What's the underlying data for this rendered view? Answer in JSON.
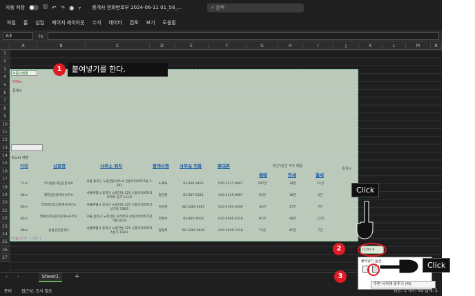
{
  "titlebar": {
    "autosave": "자동 저장",
    "doc_title": "중개사 전화번호부 2024-06-11 01_58_...",
    "search_placeholder": "검색"
  },
  "menu": [
    "파일",
    "홈",
    "삽입",
    "페이지 레이아웃",
    "수식",
    "데이터",
    "검토",
    "보기",
    "도움말"
  ],
  "formula_bar": {
    "name_box": "A3",
    "fx": "fx"
  },
  "columns": [
    "A",
    "B",
    "C",
    "D",
    "E",
    "F",
    "G",
    "H",
    "I",
    "J",
    "K",
    "L",
    "M",
    "N"
  ],
  "rows": [
    "1",
    "2",
    "3",
    "4",
    "5",
    "6",
    "7",
    "8",
    "9",
    "10",
    "11",
    "12",
    "13",
    "14",
    "15",
    "16",
    "17",
    "18",
    "19",
    "20",
    "21",
    "22",
    "23",
    "24",
    "25",
    "26",
    "27"
  ],
  "pasted": {
    "tag1": "부동산매물",
    "tag2": "500m",
    "tag3": "중개사",
    "excel_label": "Excel 저장",
    "header_note": "최근1달간 부유 매물",
    "headers": {
      "distance": "거리",
      "name": "상호명",
      "location": "사무소 위치",
      "broker": "중개사명",
      "phone": "사무실 전화",
      "rep": "휴대폰",
      "sale": "매매",
      "jeonse": "전세",
      "monthly": "월세",
      "agent": "중개사"
    },
    "rows": [
      {
        "d": "71m",
        "n": "유니빌중개공인중개사",
        "a": "서울 동작구 노량진동325-4 신동아리버파크빌 1-201",
        "b": "노혜숙",
        "p": "02-816-4422",
        "m": "010-2317-9467",
        "s": "197건",
        "j": "34건",
        "w": "12건"
      },
      {
        "d": "85m",
        "n": "착한공인중개사사무소",
        "a": "서울특별시 동작구 노량진동 325 신동아리버파크아파트 상가 111호",
        "b": "정인영",
        "p": "02-827-0321",
        "m": "010-4135-9667",
        "s": "61건",
        "j": "18건",
        "w": "2건"
      },
      {
        "d": "85m",
        "n": "리버파크공인중개사사무소",
        "a": "서울특별시 동작구 노량진동 325 신동아리버파크 상가동 108호",
        "b": "김미경",
        "p": "02-3280-4585",
        "m": "010-5763-4200",
        "s": "44건",
        "j": "27건",
        "w": "7건"
      },
      {
        "d": "85m",
        "n": "행복(단지)공인중개사사무소",
        "a": "서울 동작구 노량진동 325번지 신동아리버파크상가동101호",
        "b": "전영숙",
        "p": "02-825-9500",
        "m": "010-5585-2316",
        "s": "87건",
        "j": "48건",
        "w": "12건"
      },
      {
        "d": "89m",
        "n": "삼성공인중개사",
        "a": "서울특별시 동작구 노량진동 325 신동아리버파크A상가 102호",
        "b": "장정희",
        "p": "02-3280-5640",
        "m": "010-3295-7418",
        "s": "73건",
        "j": "60건",
        "w": "7건"
      }
    ],
    "footnote1": "1",
    "footnote2": "레코드위치: 1-5중 1"
  },
  "callout1": {
    "num": "1",
    "text": "붙여넣기를 한다."
  },
  "step2": "2",
  "step3": "3",
  "click_label": "Click",
  "paste_button": "(Ctrl) ▾",
  "paste_popup_title": "붙여넣기 옵션:",
  "tooltip": "주변 서식에 맞추기 (M)",
  "sheet_tab": "Sheet1",
  "status": {
    "ready": "준비",
    "accessibility": "접근성: 조사 필요",
    "right": "평균: 1  개수: 65  합계: 5"
  }
}
